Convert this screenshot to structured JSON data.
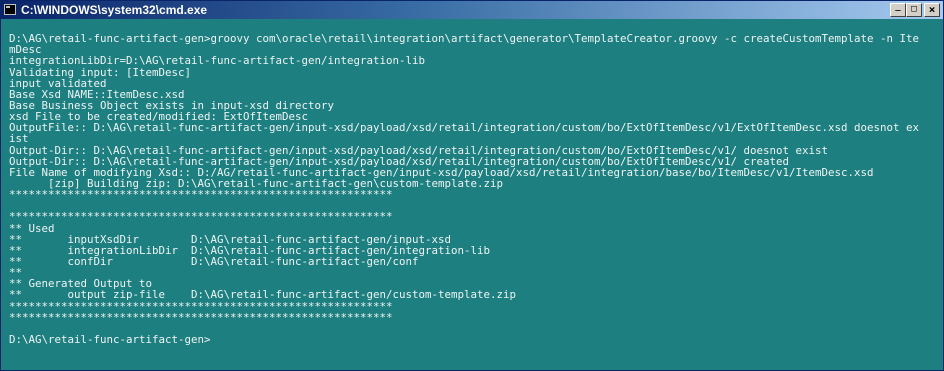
{
  "window": {
    "title": "C:\\WINDOWS\\system32\\cmd.exe",
    "icon": "cmd-icon",
    "controls": {
      "minimize": "minimize-icon",
      "maximize": "maximize-icon",
      "close": "close-icon"
    },
    "colors": {
      "console_background": "#1e7f80",
      "console_text": "#eef4f4",
      "titlebar_start": "#0a246a",
      "titlebar_end": "#a6caf0"
    }
  },
  "console": {
    "lines": [
      "",
      "D:\\AG\\retail-func-artifact-gen>groovy com\\oracle\\retail\\integration\\artifact\\generator\\TemplateCreator.groovy -c createCustomTemplate -n Ite",
      "mDesc",
      "integrationLibDir=D:\\AG\\retail-func-artifact-gen/integration-lib",
      "Validating input: [ItemDesc]",
      "input validated",
      "Base Xsd NAME::ItemDesc.xsd",
      "Base Business Object exists in input-xsd directory",
      "xsd File to be created/modified: ExtOfItemDesc",
      "OutputFile:: D:\\AG\\retail-func-artifact-gen/input-xsd/payload/xsd/retail/integration/custom/bo/ExtOfItemDesc/v1/ExtOfItemDesc.xsd doesnot ex",
      "ist",
      "Output-Dir:: D:\\AG\\retail-func-artifact-gen/input-xsd/payload/xsd/retail/integration/custom/bo/ExtOfItemDesc/v1/ doesnot exist",
      "Output-Dir:: D:\\AG\\retail-func-artifact-gen/input-xsd/payload/xsd/retail/integration/custom/bo/ExtOfItemDesc/v1/ created",
      "File Name of modifying Xsd:: D:/AG/retail-func-artifact-gen/input-xsd/payload/xsd/retail/integration/base/bo/ItemDesc/v1/ItemDesc.xsd",
      "      [zip] Building zip: D:\\AG\\retail-func-artifact-gen\\custom-template.zip",
      "***********************************************************",
      "",
      "***********************************************************",
      "** Used",
      "**       inputXsdDir        D:\\AG\\retail-func-artifact-gen/input-xsd",
      "**       integrationLibDir  D:\\AG\\retail-func-artifact-gen/integration-lib",
      "**       confDir            D:\\AG\\retail-func-artifact-gen/conf",
      "**",
      "** Generated Output to",
      "**       output zip-file    D:\\AG\\retail-func-artifact-gen/custom-template.zip",
      "***********************************************************",
      "***********************************************************",
      "",
      "D:\\AG\\retail-func-artifact-gen>"
    ]
  }
}
